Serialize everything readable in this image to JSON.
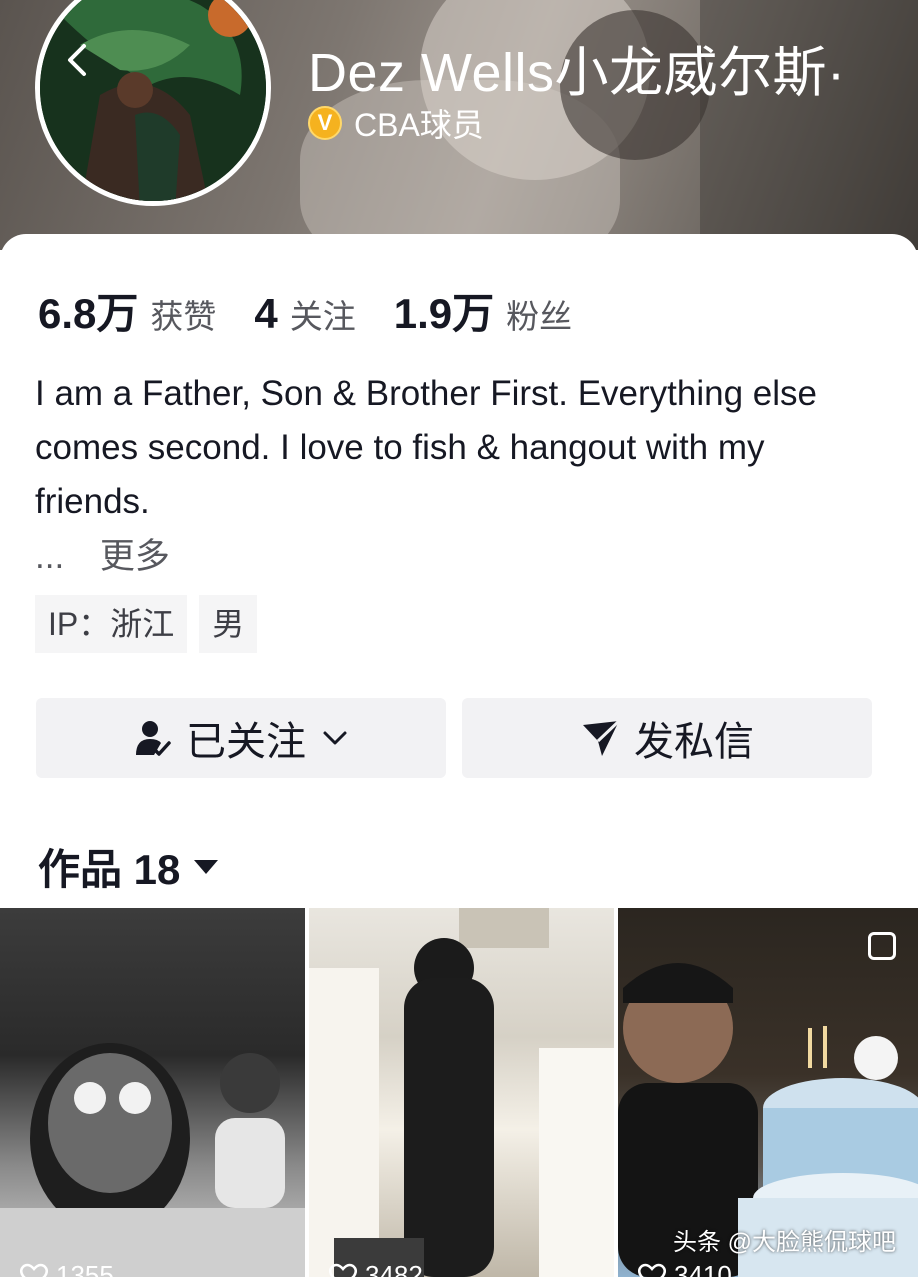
{
  "profile": {
    "name": "Dez Wells小龙威尔斯·",
    "verification": "CBA球员"
  },
  "stats": [
    {
      "value": "6.8万",
      "label": "获赞"
    },
    {
      "value": "4",
      "label": "关注"
    },
    {
      "value": "1.9万",
      "label": "粉丝"
    }
  ],
  "bio": {
    "text": "I am a Father, Son & Brother First. Everything else comes second. I love to fish & hangout with my friends.",
    "ellipsis": "...",
    "more_label": "更多"
  },
  "tags": {
    "ip": "IP：浙江",
    "gender": "男"
  },
  "buttons": {
    "follow_label": "已关注",
    "message_label": "发私信"
  },
  "works": {
    "label": "作品 18"
  },
  "thumbnails": [
    {
      "likes": "1355"
    },
    {
      "likes": "3482"
    },
    {
      "likes": "3410"
    }
  ],
  "watermark": "头条 @大脸熊侃球吧",
  "icons": {
    "back": "chevron-left-icon",
    "verify": "v-badge-icon",
    "follow": "user-check-icon",
    "message": "send-icon",
    "dropdown": "caret-down-icon",
    "heart": "heart-icon",
    "pin": "pin-icon"
  },
  "colors": {
    "accent_verify": "#f5b21f",
    "text_primary": "#161823",
    "text_secondary": "#57585e",
    "button_bg": "#f2f2f4"
  }
}
